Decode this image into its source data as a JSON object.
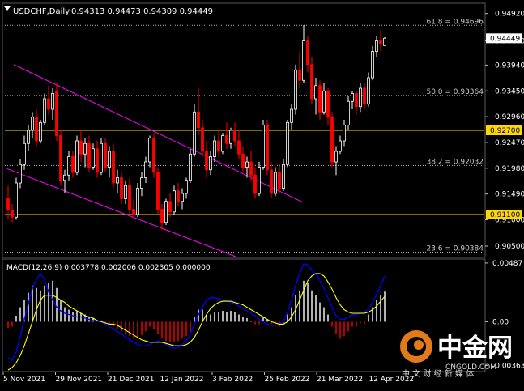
{
  "header": {
    "symbol_timeframe": "USDCHF,Daily",
    "ohlc": "0.94313 0.94473 0.94309 0.94449"
  },
  "macd_header": "MACD(12,26,9) 0.003778 0.002006 0.002305 0.000000",
  "watermark": {
    "brand": "中金网",
    "site": "CNGOLD.COM",
    "tagline": "中 文 财 经 新 媒 体"
  },
  "colors": {
    "background": "#000000",
    "up_candle": "#ffffff",
    "down_candle": "#ff0000",
    "fib_level": "#b4b4b4",
    "horizontal_level": "#ffd700",
    "channel": "#ff00ff",
    "macd_positive": "#ffffff",
    "macd_negative": "#ff0000",
    "macd_line": "#0000ff",
    "signal_line": "#ffff00",
    "price_label_bg": "#ffffff",
    "level_label_bg": "#ffd700"
  },
  "chart_data": [
    {
      "type": "candlestick",
      "title": "USDCHF,Daily",
      "price_axis_ticks": [
        "0.94920",
        "0.94400",
        "0.93940",
        "0.93450",
        "0.92960",
        "0.92470",
        "0.91980",
        "0.91490",
        "0.91000",
        "0.90500"
      ],
      "price_range": [
        0.903,
        0.951
      ],
      "x_tick_labels": [
        "5 Nov 2021",
        "29 Nov 2021",
        "21 Dec 2021",
        "12 Jan 2022",
        "3 Feb 2022",
        "25 Feb 2022",
        "21 Mar 2022",
        "12 Apr 2022"
      ],
      "current_price": "0.94449",
      "fib_levels": [
        {
          "label": "61.8 = 0.94696",
          "value": 0.94696
        },
        {
          "label": "50.0 = 0.93364",
          "value": 0.93364
        },
        {
          "label": "38.2 = 0.92032",
          "value": 0.92032
        },
        {
          "label": "23.6 = 0.90384",
          "value": 0.90384
        }
      ],
      "horizontal_levels": [
        {
          "label": "0.92700",
          "value": 0.927
        },
        {
          "label": "0.91100",
          "value": 0.911
        }
      ],
      "channel": {
        "description": "descending channel",
        "upper": [
          [
            "2021-11-01",
            0.9395
          ],
          [
            "2022-03-11",
            0.9134
          ]
        ],
        "lower": [
          [
            "2021-10-29",
            0.9197
          ],
          [
            "2022-02-09",
            0.903
          ]
        ]
      },
      "candles": [
        {
          "o": 0.914,
          "h": 0.9165,
          "l": 0.91,
          "c": 0.912
        },
        {
          "o": 0.9118,
          "h": 0.913,
          "l": 0.9095,
          "c": 0.9105
        },
        {
          "o": 0.9105,
          "h": 0.918,
          "l": 0.91,
          "c": 0.917
        },
        {
          "o": 0.917,
          "h": 0.9215,
          "l": 0.916,
          "c": 0.9205
        },
        {
          "o": 0.9205,
          "h": 0.926,
          "l": 0.9195,
          "c": 0.9245
        },
        {
          "o": 0.9245,
          "h": 0.928,
          "l": 0.923,
          "c": 0.927
        },
        {
          "o": 0.927,
          "h": 0.9305,
          "l": 0.9255,
          "c": 0.9295
        },
        {
          "o": 0.9295,
          "h": 0.931,
          "l": 0.924,
          "c": 0.925
        },
        {
          "o": 0.925,
          "h": 0.929,
          "l": 0.9245,
          "c": 0.9285
        },
        {
          "o": 0.9285,
          "h": 0.934,
          "l": 0.928,
          "c": 0.933
        },
        {
          "o": 0.933,
          "h": 0.9355,
          "l": 0.93,
          "c": 0.931
        },
        {
          "o": 0.931,
          "h": 0.935,
          "l": 0.929,
          "c": 0.934
        },
        {
          "o": 0.9345,
          "h": 0.936,
          "l": 0.925,
          "c": 0.926
        },
        {
          "o": 0.926,
          "h": 0.927,
          "l": 0.9165,
          "c": 0.9175
        },
        {
          "o": 0.9175,
          "h": 0.9195,
          "l": 0.915,
          "c": 0.9185
        },
        {
          "o": 0.9185,
          "h": 0.923,
          "l": 0.9175,
          "c": 0.922
        },
        {
          "o": 0.922,
          "h": 0.923,
          "l": 0.918,
          "c": 0.919
        },
        {
          "o": 0.919,
          "h": 0.926,
          "l": 0.9185,
          "c": 0.925
        },
        {
          "o": 0.925,
          "h": 0.927,
          "l": 0.921,
          "c": 0.9225
        },
        {
          "o": 0.9225,
          "h": 0.9255,
          "l": 0.92,
          "c": 0.9245
        },
        {
          "o": 0.9245,
          "h": 0.926,
          "l": 0.919,
          "c": 0.92
        },
        {
          "o": 0.92,
          "h": 0.9245,
          "l": 0.9195,
          "c": 0.9235
        },
        {
          "o": 0.9235,
          "h": 0.925,
          "l": 0.918,
          "c": 0.919
        },
        {
          "o": 0.919,
          "h": 0.9255,
          "l": 0.9185,
          "c": 0.9245
        },
        {
          "o": 0.9245,
          "h": 0.9255,
          "l": 0.919,
          "c": 0.92
        },
        {
          "o": 0.92,
          "h": 0.924,
          "l": 0.918,
          "c": 0.923
        },
        {
          "o": 0.923,
          "h": 0.9245,
          "l": 0.916,
          "c": 0.917
        },
        {
          "o": 0.917,
          "h": 0.9195,
          "l": 0.915,
          "c": 0.918
        },
        {
          "o": 0.918,
          "h": 0.919,
          "l": 0.913,
          "c": 0.914
        },
        {
          "o": 0.914,
          "h": 0.9175,
          "l": 0.913,
          "c": 0.9165
        },
        {
          "o": 0.9165,
          "h": 0.918,
          "l": 0.911,
          "c": 0.912
        },
        {
          "o": 0.912,
          "h": 0.914,
          "l": 0.91,
          "c": 0.911
        },
        {
          "o": 0.911,
          "h": 0.917,
          "l": 0.9105,
          "c": 0.916
        },
        {
          "o": 0.916,
          "h": 0.919,
          "l": 0.9145,
          "c": 0.918
        },
        {
          "o": 0.918,
          "h": 0.922,
          "l": 0.917,
          "c": 0.921
        },
        {
          "o": 0.921,
          "h": 0.926,
          "l": 0.92,
          "c": 0.9255
        },
        {
          "o": 0.9255,
          "h": 0.9265,
          "l": 0.918,
          "c": 0.919
        },
        {
          "o": 0.919,
          "h": 0.92,
          "l": 0.911,
          "c": 0.912
        },
        {
          "o": 0.912,
          "h": 0.913,
          "l": 0.908,
          "c": 0.9095
        },
        {
          "o": 0.9095,
          "h": 0.914,
          "l": 0.909,
          "c": 0.9135
        },
        {
          "o": 0.9135,
          "h": 0.915,
          "l": 0.9105,
          "c": 0.9115
        },
        {
          "o": 0.9115,
          "h": 0.9165,
          "l": 0.911,
          "c": 0.9155
        },
        {
          "o": 0.9155,
          "h": 0.917,
          "l": 0.9125,
          "c": 0.9135
        },
        {
          "o": 0.9135,
          "h": 0.916,
          "l": 0.912,
          "c": 0.915
        },
        {
          "o": 0.915,
          "h": 0.918,
          "l": 0.914,
          "c": 0.9175
        },
        {
          "o": 0.9175,
          "h": 0.9235,
          "l": 0.917,
          "c": 0.9225
        },
        {
          "o": 0.9225,
          "h": 0.932,
          "l": 0.922,
          "c": 0.9305
        },
        {
          "o": 0.9305,
          "h": 0.935,
          "l": 0.926,
          "c": 0.9275
        },
        {
          "o": 0.9275,
          "h": 0.929,
          "l": 0.922,
          "c": 0.923
        },
        {
          "o": 0.923,
          "h": 0.925,
          "l": 0.918,
          "c": 0.9195
        },
        {
          "o": 0.9195,
          "h": 0.923,
          "l": 0.9185,
          "c": 0.922
        },
        {
          "o": 0.922,
          "h": 0.926,
          "l": 0.921,
          "c": 0.925
        },
        {
          "o": 0.925,
          "h": 0.927,
          "l": 0.922,
          "c": 0.923
        },
        {
          "o": 0.923,
          "h": 0.9265,
          "l": 0.9225,
          "c": 0.926
        },
        {
          "o": 0.926,
          "h": 0.9285,
          "l": 0.9235,
          "c": 0.9245
        },
        {
          "o": 0.9245,
          "h": 0.9275,
          "l": 0.9235,
          "c": 0.927
        },
        {
          "o": 0.927,
          "h": 0.9285,
          "l": 0.924,
          "c": 0.925
        },
        {
          "o": 0.925,
          "h": 0.927,
          "l": 0.9215,
          "c": 0.9225
        },
        {
          "o": 0.9225,
          "h": 0.924,
          "l": 0.919,
          "c": 0.92
        },
        {
          "o": 0.92,
          "h": 0.922,
          "l": 0.918,
          "c": 0.921
        },
        {
          "o": 0.921,
          "h": 0.923,
          "l": 0.9175,
          "c": 0.9185
        },
        {
          "o": 0.9185,
          "h": 0.92,
          "l": 0.914,
          "c": 0.915
        },
        {
          "o": 0.915,
          "h": 0.921,
          "l": 0.9145,
          "c": 0.92
        },
        {
          "o": 0.92,
          "h": 0.929,
          "l": 0.9195,
          "c": 0.928
        },
        {
          "o": 0.928,
          "h": 0.929,
          "l": 0.9185,
          "c": 0.9195
        },
        {
          "o": 0.9195,
          "h": 0.921,
          "l": 0.914,
          "c": 0.915
        },
        {
          "o": 0.915,
          "h": 0.92,
          "l": 0.9145,
          "c": 0.919
        },
        {
          "o": 0.919,
          "h": 0.9205,
          "l": 0.915,
          "c": 0.916
        },
        {
          "o": 0.916,
          "h": 0.9215,
          "l": 0.9155,
          "c": 0.9205
        },
        {
          "o": 0.9205,
          "h": 0.929,
          "l": 0.92,
          "c": 0.9285
        },
        {
          "o": 0.9285,
          "h": 0.932,
          "l": 0.927,
          "c": 0.931
        },
        {
          "o": 0.931,
          "h": 0.9395,
          "l": 0.93,
          "c": 0.9385
        },
        {
          "o": 0.9385,
          "h": 0.942,
          "l": 0.935,
          "c": 0.9365
        },
        {
          "o": 0.9365,
          "h": 0.947,
          "l": 0.936,
          "c": 0.944
        },
        {
          "o": 0.944,
          "h": 0.945,
          "l": 0.938,
          "c": 0.9395
        },
        {
          "o": 0.9395,
          "h": 0.941,
          "l": 0.932,
          "c": 0.933
        },
        {
          "o": 0.933,
          "h": 0.937,
          "l": 0.93,
          "c": 0.9355
        },
        {
          "o": 0.9355,
          "h": 0.9365,
          "l": 0.929,
          "c": 0.9305
        },
        {
          "o": 0.9305,
          "h": 0.936,
          "l": 0.93,
          "c": 0.9345
        },
        {
          "o": 0.9345,
          "h": 0.935,
          "l": 0.928,
          "c": 0.9295
        },
        {
          "o": 0.9295,
          "h": 0.9305,
          "l": 0.92,
          "c": 0.921
        },
        {
          "o": 0.921,
          "h": 0.924,
          "l": 0.9185,
          "c": 0.923
        },
        {
          "o": 0.923,
          "h": 0.926,
          "l": 0.9225,
          "c": 0.925
        },
        {
          "o": 0.925,
          "h": 0.929,
          "l": 0.924,
          "c": 0.928
        },
        {
          "o": 0.928,
          "h": 0.9335,
          "l": 0.927,
          "c": 0.9325
        },
        {
          "o": 0.9325,
          "h": 0.9345,
          "l": 0.931,
          "c": 0.934
        },
        {
          "o": 0.934,
          "h": 0.9345,
          "l": 0.93,
          "c": 0.9315
        },
        {
          "o": 0.9315,
          "h": 0.936,
          "l": 0.9305,
          "c": 0.935
        },
        {
          "o": 0.935,
          "h": 0.936,
          "l": 0.931,
          "c": 0.932
        },
        {
          "o": 0.932,
          "h": 0.938,
          "l": 0.9315,
          "c": 0.937
        },
        {
          "o": 0.937,
          "h": 0.943,
          "l": 0.9365,
          "c": 0.942
        },
        {
          "o": 0.942,
          "h": 0.945,
          "l": 0.941,
          "c": 0.944
        },
        {
          "o": 0.944,
          "h": 0.946,
          "l": 0.942,
          "c": 0.9435
        },
        {
          "o": 0.9431,
          "h": 0.9447,
          "l": 0.9431,
          "c": 0.9445
        }
      ]
    },
    {
      "type": "bar",
      "title": "MACD(12,26,9) 0.003778 0.002006 0.002305 0.000000",
      "y_ticks": [
        "0.00487",
        "0.00",
        "-0.00363"
      ],
      "y_range": [
        -0.004,
        0.005
      ],
      "histogram": [
        -0.0005,
        -0.0004,
        0.0005,
        0.0012,
        0.0018,
        0.0024,
        0.003,
        0.0028,
        0.0026,
        0.003,
        0.0032,
        0.0034,
        0.0028,
        0.0018,
        0.0012,
        0.001,
        0.0008,
        0.0009,
        0.0007,
        0.0006,
        0.0004,
        0.0003,
        0.0001,
        0.0001,
        -0.0001,
        -0.0002,
        -0.0004,
        -0.0006,
        -0.0008,
        -0.001,
        -0.0012,
        -0.0014,
        -0.0013,
        -0.0011,
        -0.0008,
        -0.0004,
        -0.0006,
        -0.001,
        -0.0014,
        -0.0016,
        -0.0017,
        -0.0017,
        -0.0016,
        -0.0014,
        -0.0012,
        -0.0008,
        0.0004,
        0.001,
        0.001,
        0.0006,
        0.0006,
        0.0008,
        0.0008,
        0.0009,
        0.0008,
        0.0009,
        0.0008,
        0.0006,
        0.0004,
        0.0003,
        0.0001,
        -0.0002,
        -0.0002,
        0.0004,
        0.0002,
        -0.0002,
        -0.0002,
        -0.0004,
        -0.0002,
        0.0006,
        0.0012,
        0.0022,
        0.0026,
        0.0034,
        0.0032,
        0.0026,
        0.0022,
        0.0016,
        0.0012,
        0.0006,
        -0.0004,
        -0.001,
        -0.0014,
        -0.0012,
        -0.0008,
        -0.0004,
        -0.0004,
        -0.0001,
        -0.0002,
        0.0006,
        0.0012,
        0.0018,
        0.0022,
        0.0025
      ],
      "macd_line": [
        -0.003,
        -0.0032,
        -0.0025,
        -0.0012,
        0.0002,
        0.0015,
        0.0028,
        0.0035,
        0.004,
        0.0035,
        0.0025,
        0.0018,
        0.0012,
        0.0009,
        0.0007,
        0.0006,
        0.0005,
        0.0004,
        0.0004,
        0.0003,
        0.0002,
        0.0001,
        0.0,
        0.0,
        -0.0002,
        -0.0004,
        -0.0006,
        -0.0008,
        -0.001,
        -0.0013,
        -0.0015,
        -0.0017,
        -0.0019,
        -0.002,
        -0.002,
        -0.0019,
        -0.0017,
        -0.0016,
        -0.0017,
        -0.0019,
        -0.0021,
        -0.0022,
        -0.0021,
        -0.0019,
        -0.0016,
        -0.001,
        -0.0002,
        0.0006,
        0.0012,
        0.0018,
        0.002,
        0.002,
        0.0019,
        0.0018,
        0.0017,
        0.0016,
        0.0015,
        0.0013,
        0.0011,
        0.0009,
        0.0007,
        0.0005,
        0.0002,
        0.0,
        -0.0002,
        -0.0003,
        -0.0003,
        -0.0002,
        0.0,
        0.0008,
        0.0018,
        0.003,
        0.004,
        0.0048,
        0.0047,
        0.0043,
        0.0039,
        0.0034,
        0.0028,
        0.002,
        0.0012,
        0.0005,
        0.0002,
        0.0002,
        0.0004,
        0.0006,
        0.0006,
        0.0007,
        0.0008,
        0.001,
        0.0016,
        0.0023,
        0.003,
        0.0038
      ],
      "signal_line": [
        -0.004,
        -0.0038,
        -0.0034,
        -0.0028,
        -0.002,
        -0.001,
        0.0,
        0.001,
        0.0018,
        0.0022,
        0.0022,
        0.0022,
        0.002,
        0.0018,
        0.0016,
        0.0013,
        0.0011,
        0.0009,
        0.0007,
        0.0005,
        0.0004,
        0.0003,
        0.0001,
        0.0,
        -0.0001,
        -0.0002,
        -0.0002,
        -0.0003,
        -0.0005,
        -0.0007,
        -0.0009,
        -0.0011,
        -0.0013,
        -0.0015,
        -0.0016,
        -0.0017,
        -0.0017,
        -0.0017,
        -0.0017,
        -0.0018,
        -0.0019,
        -0.002,
        -0.002,
        -0.002,
        -0.0019,
        -0.0017,
        -0.0013,
        -0.0007,
        0.0,
        0.0006,
        0.0011,
        0.0014,
        0.0016,
        0.0017,
        0.0017,
        0.0017,
        0.0016,
        0.0015,
        0.0014,
        0.0012,
        0.001,
        0.0008,
        0.0006,
        0.0004,
        0.0002,
        0.0,
        -0.0001,
        -0.0002,
        -0.0002,
        0.0,
        0.0004,
        0.001,
        0.0018,
        0.0026,
        0.0034,
        0.0038,
        0.004,
        0.004,
        0.0038,
        0.0033,
        0.0027,
        0.002,
        0.0014,
        0.001,
        0.0008,
        0.0007,
        0.0007,
        0.0007,
        0.0007,
        0.0008,
        0.001,
        0.0013,
        0.0017,
        0.0021
      ]
    }
  ]
}
